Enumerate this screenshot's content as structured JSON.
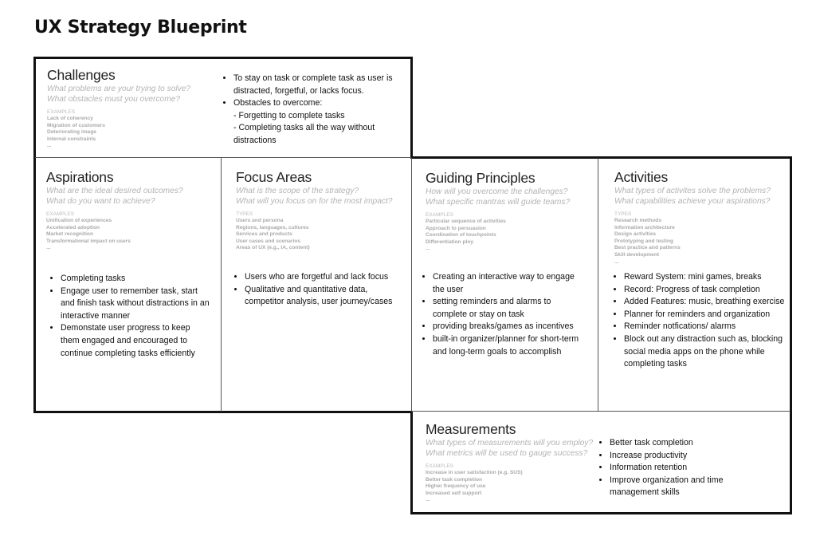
{
  "title": "UX Strategy Blueprint",
  "sections": {
    "challenges": {
      "heading": "Challenges",
      "questions": [
        "What problems are your trying to solve?",
        "What obstacles must you overcome?"
      ],
      "examples_label": "EXAMPLES",
      "examples": [
        "Lack of coherency",
        "Migration of customers",
        "Deteriorating image",
        "Internal constraints",
        "..."
      ],
      "bullets": [
        {
          "text": "To stay on task or complete task as user is distracted, forgetful, or lacks focus."
        },
        {
          "text": "Obstacles to overcome:",
          "sub": [
            "- Forgetting to complete tasks",
            "- Completing tasks all the way without distractions"
          ]
        }
      ]
    },
    "aspirations": {
      "heading": "Aspirations",
      "questions": [
        "What are the ideal desired outcomes?",
        "What do you want to achieve?"
      ],
      "examples_label": "EXAMPLES",
      "examples": [
        "Unification of experiences",
        "Accelerated adoption",
        "Market recognition",
        "Transformational impact on users",
        "..."
      ],
      "bullets": [
        "Completing tasks",
        "Engage user to remember task, start and finish task without distractions in an interactive manner",
        "Demonstate user progress to keep them engaged and encouraged to continue completing tasks efficiently"
      ]
    },
    "focus_areas": {
      "heading": "Focus Areas",
      "questions": [
        "What is the scope of the strategy?",
        "What will you focus on for the most impact?"
      ],
      "examples_label": "TYPES",
      "examples": [
        "Users and persona",
        "Regions, languages, cultures",
        "Services and products",
        "User cases and scenarios",
        "Areas of UX (e.g., IA, content)"
      ],
      "bullets": [
        "Users who are forgetful and lack focus",
        "Qualitative and quantitative data, competitor analysis, user journey/cases"
      ]
    },
    "guiding_principles": {
      "heading": "Guiding Principles",
      "questions": [
        "How will you overcome the challenges?",
        "What specific mantras will guide teams?"
      ],
      "examples_label": "EXAMPLES",
      "examples": [
        "Particular sequence of activities",
        "Approach to persuasion",
        "Coordination of touchpoints",
        "Differentiation ploy",
        "..."
      ],
      "bullets": [
        "Creating an interactive way to engage the user",
        "setting reminders and alarms to complete or stay on task",
        "providing breaks/games as incentives",
        "built-in organizer/planner for short-term and long-term goals to accomplish"
      ]
    },
    "activities": {
      "heading": "Activities",
      "questions": [
        "What types of activites solve the problems?",
        "What capabilities achieve your aspirations?"
      ],
      "examples_label": "TYPES",
      "examples": [
        "Research methods",
        "Information architecture",
        "Design activities",
        "Prototyping and testing",
        "Best practice and patterns",
        "Skill development",
        "..."
      ],
      "bullets": [
        "Reward System: mini games, breaks",
        "Record: Progress of task completion",
        "Added Features: music, breathing exercise",
        "Planner for reminders and organization",
        "Reminder notfications/ alarms",
        "Block out any distraction such as, blocking social media apps on the phone while completing tasks"
      ]
    },
    "measurements": {
      "heading": "Measurements",
      "questions": [
        "What types of measurements will you employ?",
        "What metrics will be used to gauge success?"
      ],
      "examples_label": "EXAMPLES",
      "examples": [
        "Increase in user satisfaction (e.g. SUS)",
        "Better task completion",
        "Higher frequency of use",
        "Increased self support",
        "..."
      ],
      "bullets": [
        "Better task completion",
        "Increase productivity",
        "Information retention",
        "Improve organization and time management skills"
      ]
    }
  }
}
